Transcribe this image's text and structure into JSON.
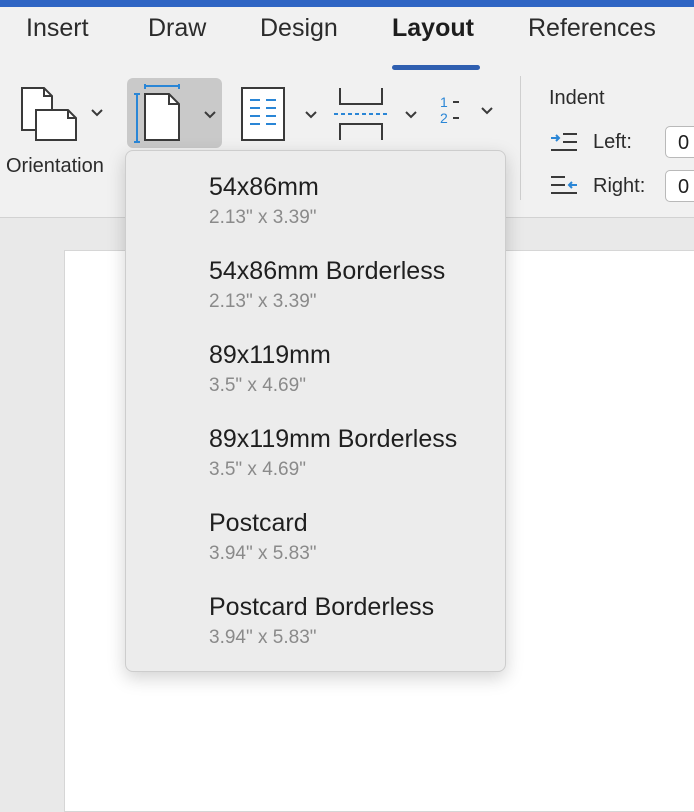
{
  "tabs": [
    {
      "label": "Insert"
    },
    {
      "label": "Draw"
    },
    {
      "label": "Design"
    },
    {
      "label": "Layout"
    },
    {
      "label": "References"
    }
  ],
  "toolbar": {
    "orientation_label": "Orientation"
  },
  "indent": {
    "title": "Indent",
    "left_label": "Left:",
    "left_value": "0",
    "right_label": "Right:",
    "right_value": "0"
  },
  "size_menu": {
    "items": [
      {
        "name": "54x86mm",
        "dims": "2.13\" x 3.39\""
      },
      {
        "name": "54x86mm Borderless",
        "dims": "2.13\" x 3.39\""
      },
      {
        "name": "89x119mm",
        "dims": "3.5\" x 4.69\""
      },
      {
        "name": "89x119mm Borderless",
        "dims": "3.5\" x 4.69\""
      },
      {
        "name": "Postcard",
        "dims": "3.94\" x 5.83\""
      },
      {
        "name": "Postcard Borderless",
        "dims": "3.94\" x 5.83\""
      }
    ]
  },
  "colors": {
    "accent": "#2f65c4",
    "icon_blue": "#2a86d6",
    "active_underline": "#2f5fb0"
  }
}
